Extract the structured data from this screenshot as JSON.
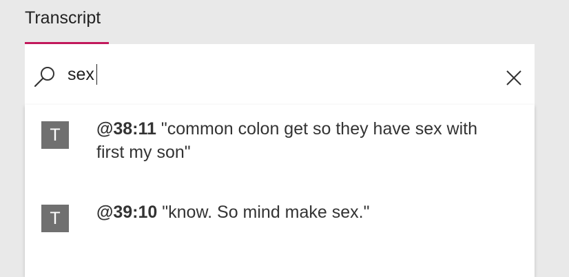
{
  "tabs": [
    {
      "label": "Transcript",
      "active": true
    }
  ],
  "accent_color": "#c2185b",
  "search": {
    "value": "sex",
    "icon": "search-icon",
    "clear_icon": "close-icon"
  },
  "results": [
    {
      "icon_letter": "T",
      "time": "@38:11",
      "text": " \"common colon get so they have sex with first my son\""
    },
    {
      "icon_letter": "T",
      "time": "@39:10",
      "text": " \"know. So mind make sex.\""
    }
  ]
}
